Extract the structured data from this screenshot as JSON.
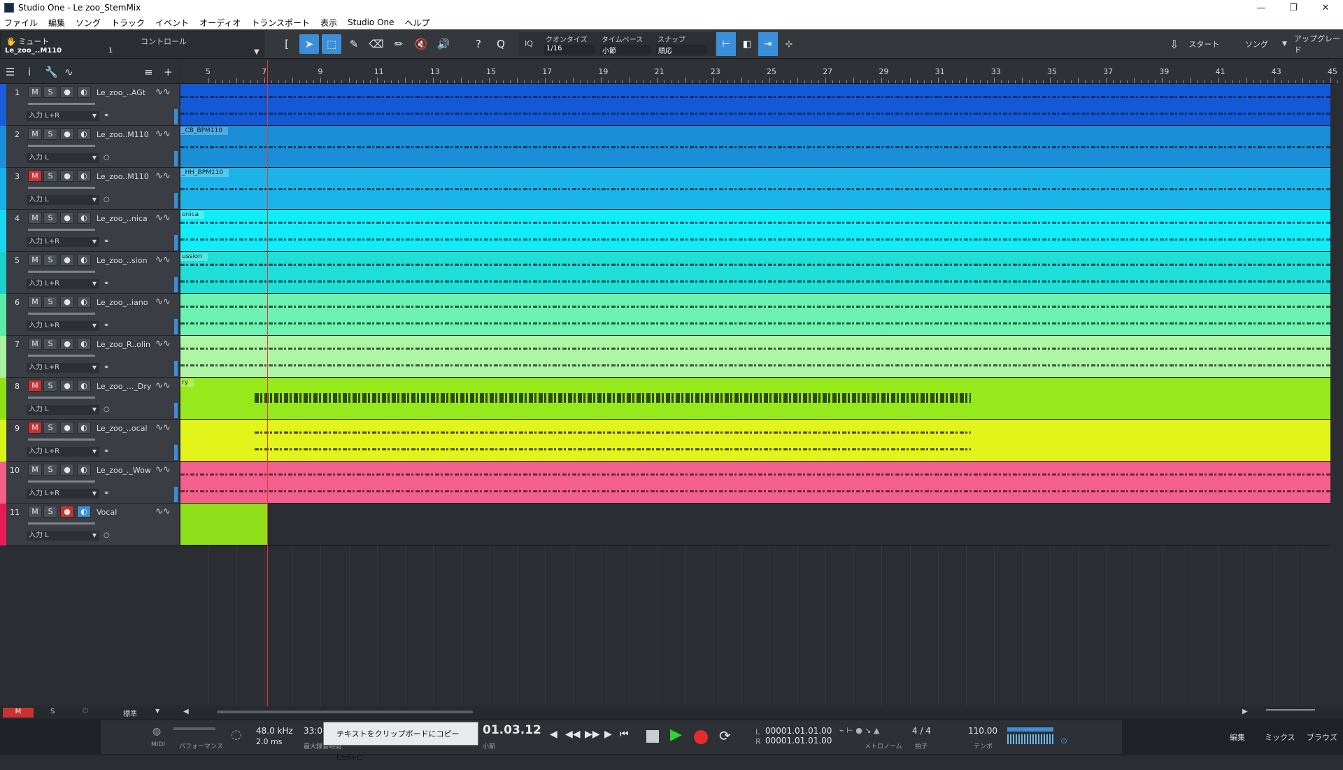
{
  "window": {
    "title": "Studio One - Le zoo_StemMix"
  },
  "menu": [
    "ファイル",
    "編集",
    "ソング",
    "トラック",
    "イベント",
    "オーディオ",
    "トランスポート",
    "表示",
    "Studio One",
    "ヘルプ"
  ],
  "toolbar": {
    "mute_label": "ミュート",
    "control_label": "コントロール",
    "track_label": "Le_zoo_..M110",
    "num_label": "1",
    "quantize_label": "クオンタイズ",
    "quantize_value": "1/16",
    "timebase_label": "タイムベース",
    "timebase_value": "小節",
    "snap_label": "スナップ",
    "snap_value": "順応",
    "iq": "IQ",
    "start": "スタート",
    "song": "ソング",
    "upgrade": "アップグレード"
  },
  "ruler": [
    "5",
    "7",
    "9",
    "11",
    "13",
    "15",
    "17",
    "19",
    "21",
    "23",
    "25",
    "27",
    "29",
    "31",
    "33",
    "35",
    "37",
    "39",
    "41",
    "43",
    "45"
  ],
  "tracks": [
    {
      "num": "1",
      "name": "Le_zoo_..AGt",
      "input": "入力 L+R",
      "color": "#1a5fd8",
      "m_red": false,
      "clip": "",
      "lane": "#1358d4",
      "wave": "#0b2e6e"
    },
    {
      "num": "2",
      "name": "Le_zoo..M110",
      "input": "入力 L",
      "color": "#1a8fd8",
      "m_red": false,
      "clip": "_CB_BPM110",
      "lane": "#1a8ed6",
      "wave": "#0a3c63"
    },
    {
      "num": "3",
      "name": "Le_zoo..M110",
      "input": "入力 L",
      "color": "#18b0e8",
      "m_red": true,
      "clip": "_HH_BPM110",
      "lane": "#1cb4e8",
      "wave": "#0a4a63"
    },
    {
      "num": "4",
      "name": "Le_zoo_..nica",
      "input": "入力 L+R",
      "color": "#1ad6f0",
      "m_red": false,
      "clip": "onica",
      "lane": "#10ecf8",
      "wave": "#0a5a63"
    },
    {
      "num": "5",
      "name": "Le_zoo_..sion",
      "input": "入力 L+R",
      "color": "#1ad0c8",
      "m_red": false,
      "clip": "ussion",
      "lane": "#1ee0d8",
      "wave": "#0a4a48"
    },
    {
      "num": "6",
      "name": "Le_zoo_..iano",
      "input": "入力 L+R",
      "color": "#5fe8a8",
      "m_red": false,
      "clip": "",
      "lane": "#6ef2b2",
      "wave": "#1f5a40"
    },
    {
      "num": "7",
      "name": "Le_zoo_R..olin",
      "input": "入力 L+R",
      "color": "#a8f0a0",
      "m_red": false,
      "clip": "",
      "lane": "#aef5a6",
      "wave": "#3a5a38"
    },
    {
      "num": "8",
      "name": "Le_zoo_..._Dry",
      "input": "入力 L",
      "color": "#8fe01a",
      "m_red": true,
      "clip": "ry",
      "lane": "#96ea1c",
      "wave": "#2f4a0a"
    },
    {
      "num": "9",
      "name": "Le_zoo_..ocal",
      "input": "入力 L+R",
      "color": "#d8f51a",
      "m_red": true,
      "clip": "",
      "lane": "#e2f41a",
      "wave": "#4a4a0a"
    },
    {
      "num": "10",
      "name": "Le_zoo_._Wow",
      "input": "入力 L+R",
      "color": "#f0608a",
      "m_red": false,
      "clip": "",
      "lane": "#f4608e",
      "wave": "#6a2a3a"
    },
    {
      "num": "11",
      "name": "Vocal",
      "input": "入力 L",
      "color": "#e81a5a",
      "m_red": false,
      "clip": "",
      "lane": "",
      "wave": ""
    }
  ],
  "status": {
    "m": "M",
    "s": "S",
    "power": "⏻",
    "std": "標準"
  },
  "transport": {
    "midi": "MIDI",
    "performance": "パフォーマンス",
    "rate": "48.0 kHz",
    "latency": "2.0 ms",
    "rec_time": "33:0",
    "rec_label": "最大録音時間",
    "position": "01.03.12",
    "pos_label": "小節",
    "L": "00001.01.01.00",
    "R": "00001.01.01.00",
    "metronome": "メトロノーム",
    "sig": "4 / 4",
    "sig_label": "拍子",
    "tempo": "110.00",
    "tempo_label": "テンポ"
  },
  "tooltip": "テキストをクリップボードにコピー   Ctrl+C",
  "views": {
    "edit": "編集",
    "mix": "ミックス",
    "browse": "ブラウズ"
  }
}
